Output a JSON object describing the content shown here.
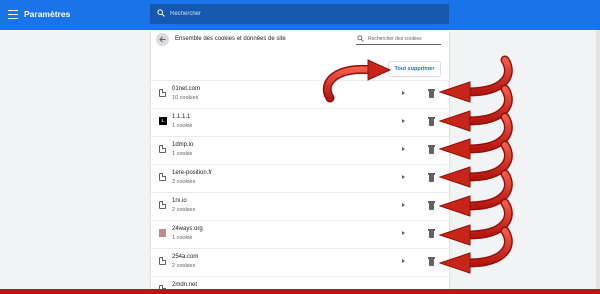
{
  "header": {
    "title": "Paramètres",
    "search_placeholder": "Rechercher"
  },
  "panel": {
    "title": "Ensemble des cookies et données de site",
    "filter_placeholder": "Rechercher des cookies",
    "delete_all_label": "Tout supprimer"
  },
  "sites": [
    {
      "name": "01net.com",
      "count": "10 cookies",
      "icon": "doc-icon"
    },
    {
      "name": "1.1.1.1",
      "count": "1 cookie",
      "icon": "favicon-1.1.1.1",
      "favicon_text": "1."
    },
    {
      "name": "1dmp.io",
      "count": "1 cookie",
      "icon": "doc-icon"
    },
    {
      "name": "1ere-position.fr",
      "count": "3 cookies",
      "icon": "doc-icon"
    },
    {
      "name": "1rx.io",
      "count": "2 cookies",
      "icon": "doc-icon"
    },
    {
      "name": "24ways.org",
      "count": "1 cookie",
      "icon": "favicon-24ways"
    },
    {
      "name": "254a.com",
      "count": "2 cookies",
      "icon": "doc-icon"
    },
    {
      "name": "2mdn.net",
      "count": "",
      "icon": "doc-icon"
    }
  ],
  "colors": {
    "accent": "#1a73e8",
    "annotation_arrow": "#d42a1f",
    "taskbar": "#b3171c"
  }
}
